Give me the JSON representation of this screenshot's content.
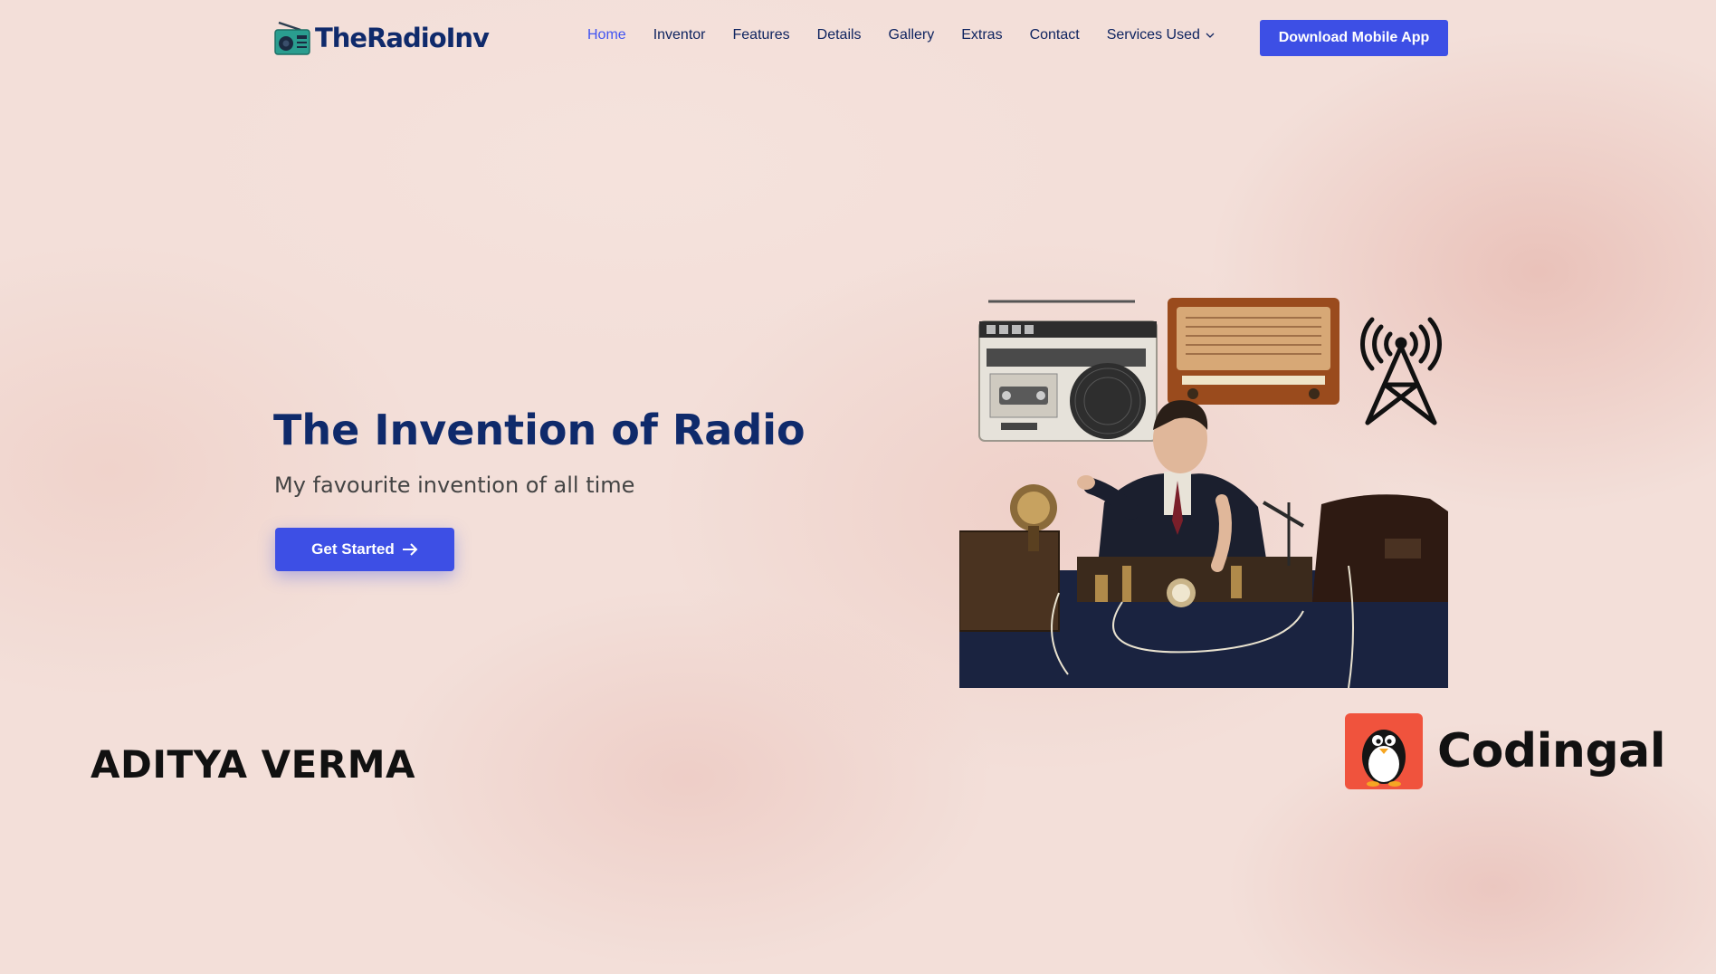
{
  "header": {
    "logo_text": "TheRadioInv",
    "nav": [
      {
        "label": "Home",
        "active": true
      },
      {
        "label": "Inventor"
      },
      {
        "label": "Features"
      },
      {
        "label": "Details"
      },
      {
        "label": "Gallery"
      },
      {
        "label": "Extras"
      },
      {
        "label": "Contact"
      },
      {
        "label": "Services Used",
        "dropdown": true
      }
    ],
    "download_button": "Download Mobile App"
  },
  "hero": {
    "title": "The Invention of Radio",
    "subtitle": "My favourite invention of all time",
    "cta_label": "Get Started"
  },
  "footer": {
    "author": "ADITYA VERMA",
    "brand": "Codingal"
  },
  "icons": {
    "logo": "radio-icon",
    "cta_arrow": "arrow-right-icon",
    "dropdown": "chevron-down-icon",
    "antenna": "radio-tower-icon",
    "brand": "penguin-icon"
  },
  "colors": {
    "accent": "#4154f1",
    "button": "#3d4fe5",
    "heading": "#0f2a6b",
    "brand_bg": "#f0533d"
  }
}
